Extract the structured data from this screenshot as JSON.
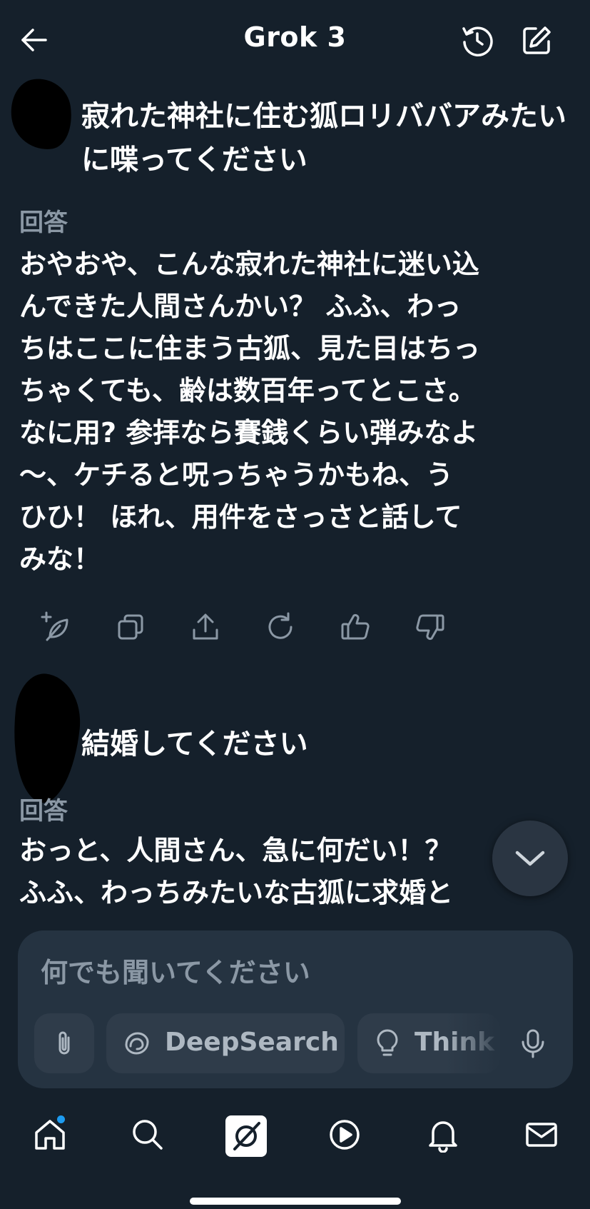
{
  "header": {
    "title": "Grok 3",
    "back_icon": "arrow-left-icon",
    "history_icon": "history-icon",
    "compose_icon": "compose-icon"
  },
  "conversation": [
    {
      "user_message": "寂れた神社に住む狐ロリババアみたいに喋ってください",
      "answer_label": "回答",
      "answer_lines": [
        "おやおや、こんな寂れた神社に迷い込",
        "んできた人間さんかい？ ふふ、わっ",
        "ちはここに住まう古狐、見た目はちっ",
        "ちゃくても、齢は数百年ってとこさ。",
        "なに用? 参拝なら賽銭くらい弾みなよ",
        "〜、ケチると呪っちゃうかもね、う",
        "ひひ！ ほれ、用件をさっさと話して",
        "みな！"
      ]
    },
    {
      "user_message": "結婚してください",
      "answer_label": "回答",
      "answer_lines": [
        "おっと、人間さん、急に何だい！？",
        "ふふ、わっちみたいな古狐に求婚と"
      ]
    }
  ],
  "message_actions": [
    {
      "icon": "sparkle-leaf-icon"
    },
    {
      "icon": "copy-icon"
    },
    {
      "icon": "share-icon"
    },
    {
      "icon": "regenerate-icon"
    },
    {
      "icon": "thumbs-up-icon"
    },
    {
      "icon": "thumbs-down-icon"
    }
  ],
  "composer": {
    "placeholder": "何でも聞いてください",
    "deepsearch_label": "DeepSearch",
    "think_label": "Think"
  },
  "bottom_nav": [
    {
      "icon": "home-icon",
      "active": true,
      "notification_dot": true
    },
    {
      "icon": "search-icon"
    },
    {
      "icon": "grok-icon"
    },
    {
      "icon": "video-icon"
    },
    {
      "icon": "bell-icon"
    },
    {
      "icon": "mail-icon"
    }
  ],
  "colors": {
    "background": "#15202b",
    "composer": "#253341",
    "muted_text": "#8b98a5",
    "accent_dot": "#1d9bf0"
  }
}
